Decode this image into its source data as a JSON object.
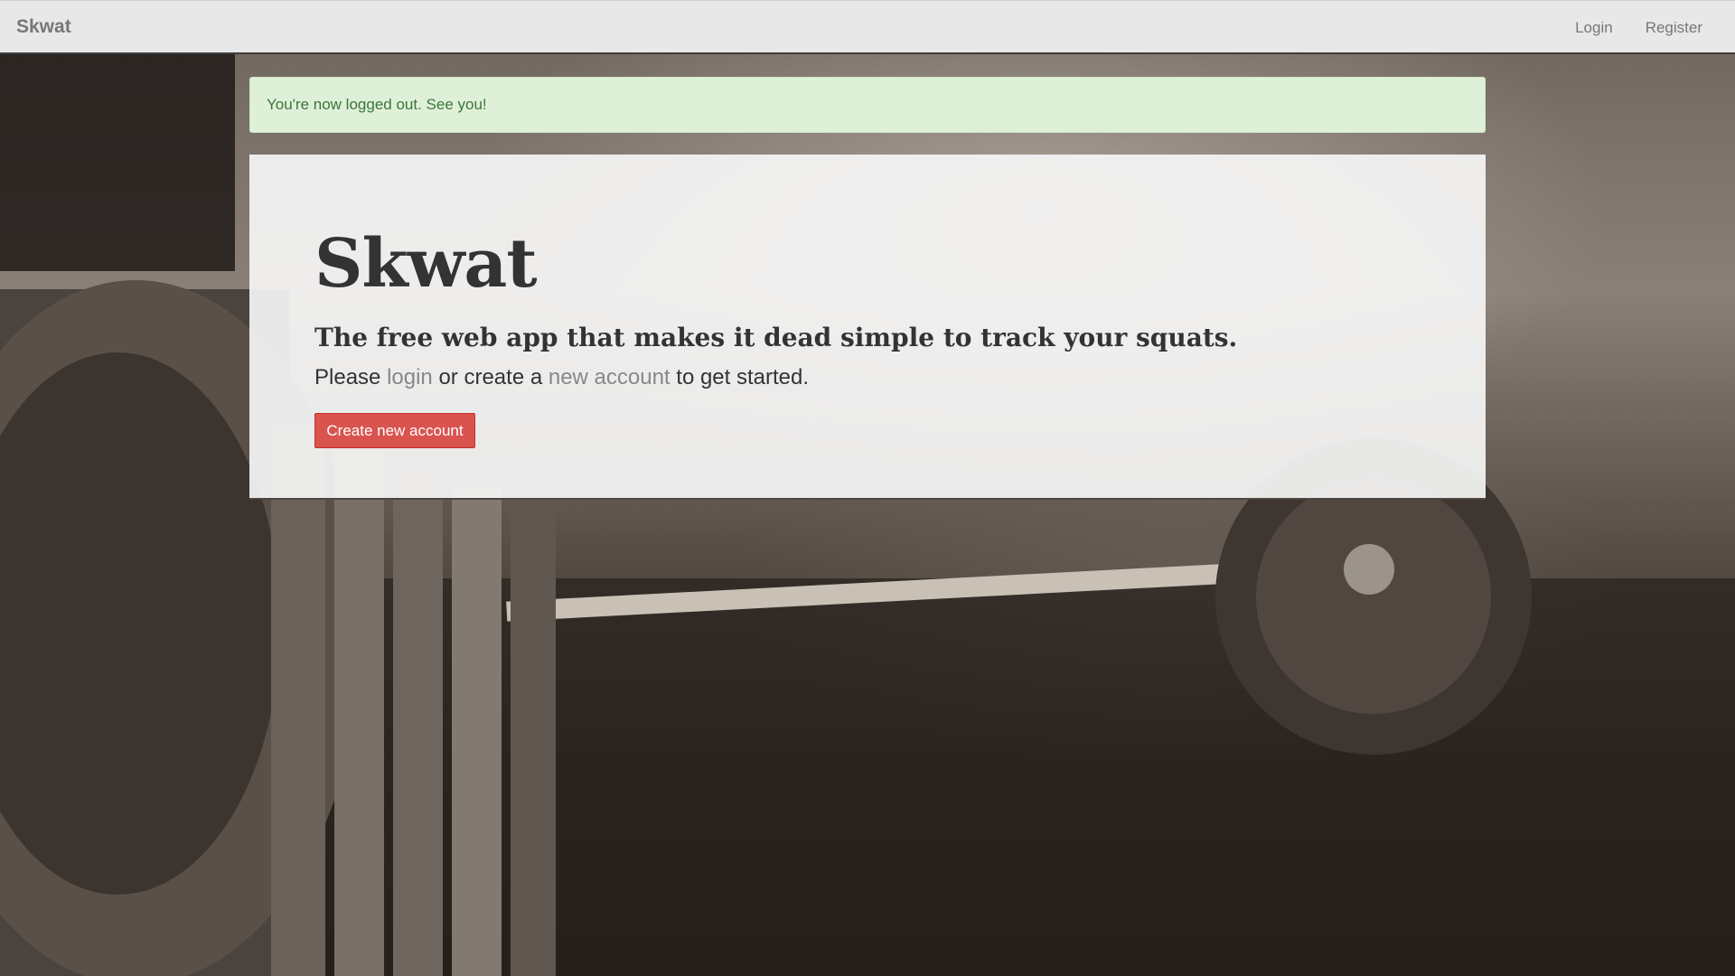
{
  "navbar": {
    "brand": "Skwat",
    "links": [
      {
        "label": "Login"
      },
      {
        "label": "Register"
      }
    ]
  },
  "alert": {
    "message": "You're now logged out. See you!"
  },
  "hero": {
    "title": "Skwat",
    "tagline": "The free web app that makes it dead simple to track your squats.",
    "text_prefix": "Please ",
    "login_link": "login",
    "text_middle": " or create a ",
    "account_link": "new account",
    "text_suffix": " to get started.",
    "create_button": "Create new account"
  },
  "colors": {
    "alert_bg": "#dff0d8",
    "alert_text": "#3c763d",
    "button_bg": "#d9534f",
    "navbar_bg": "#e8e8e8"
  }
}
